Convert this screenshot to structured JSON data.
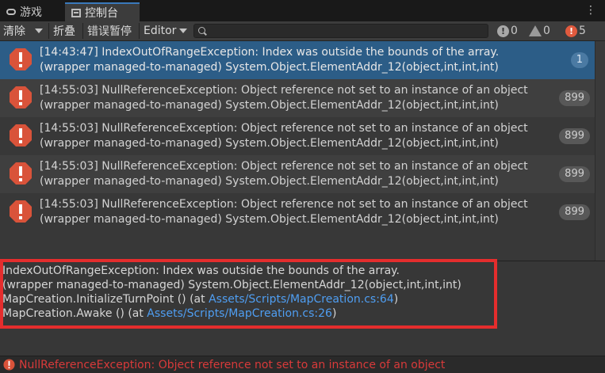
{
  "tabs": [
    {
      "label": "游戏",
      "icon": "gamepad-icon"
    },
    {
      "label": "控制台",
      "icon": "console-icon"
    }
  ],
  "window_menu": "⋮",
  "toolbar": {
    "clear_label": "清除",
    "collapse_label": "折叠",
    "error_pause_label": "错误暂停",
    "editor_label": "Editor",
    "search_placeholder": "",
    "info_count": "0",
    "warning_count": "0",
    "error_count": "5"
  },
  "log": [
    {
      "line1": "[14:43:47] IndexOutOfRangeException: Index was outside the bounds of the array.",
      "line2": "(wrapper managed-to-managed) System.Object.ElementAddr_12(object,int,int,int)",
      "count": "1",
      "selected": true
    },
    {
      "line1": "[14:55:03] NullReferenceException: Object reference not set to an instance of an object",
      "line2": "(wrapper managed-to-managed) System.Object.ElementAddr_12(object,int,int,int)",
      "count": "899"
    },
    {
      "line1": "[14:55:03] NullReferenceException: Object reference not set to an instance of an object",
      "line2": "(wrapper managed-to-managed) System.Object.ElementAddr_12(object,int,int,int)",
      "count": "899"
    },
    {
      "line1": "[14:55:03] NullReferenceException: Object reference not set to an instance of an object",
      "line2": "(wrapper managed-to-managed) System.Object.ElementAddr_12(object,int,int,int)",
      "count": "899"
    },
    {
      "line1": "[14:55:03] NullReferenceException: Object reference not set to an instance of an object",
      "line2": "(wrapper managed-to-managed) System.Object.ElementAddr_12(object,int,int,int)",
      "count": "899"
    }
  ],
  "detail": {
    "line1": "IndexOutOfRangeException: Index was outside the bounds of the array.",
    "line2": "(wrapper managed-to-managed) System.Object.ElementAddr_12(object,int,int,int)",
    "line3_prefix": "MapCreation.InitializeTurnPoint () (at ",
    "line3_link": "Assets/Scripts/MapCreation.cs:64",
    "line3_suffix": ")",
    "line4_prefix": "MapCreation.Awake () (at ",
    "line4_link": "Assets/Scripts/MapCreation.cs:26",
    "line4_suffix": ")"
  },
  "status": {
    "message": "NullReferenceException: Object reference not set to an instance of an object"
  },
  "colors": {
    "error_red": "#d9533a",
    "selected_row": "#2c5d87",
    "link_blue": "#4f9ef2",
    "highlight_border": "#e42d2d"
  }
}
